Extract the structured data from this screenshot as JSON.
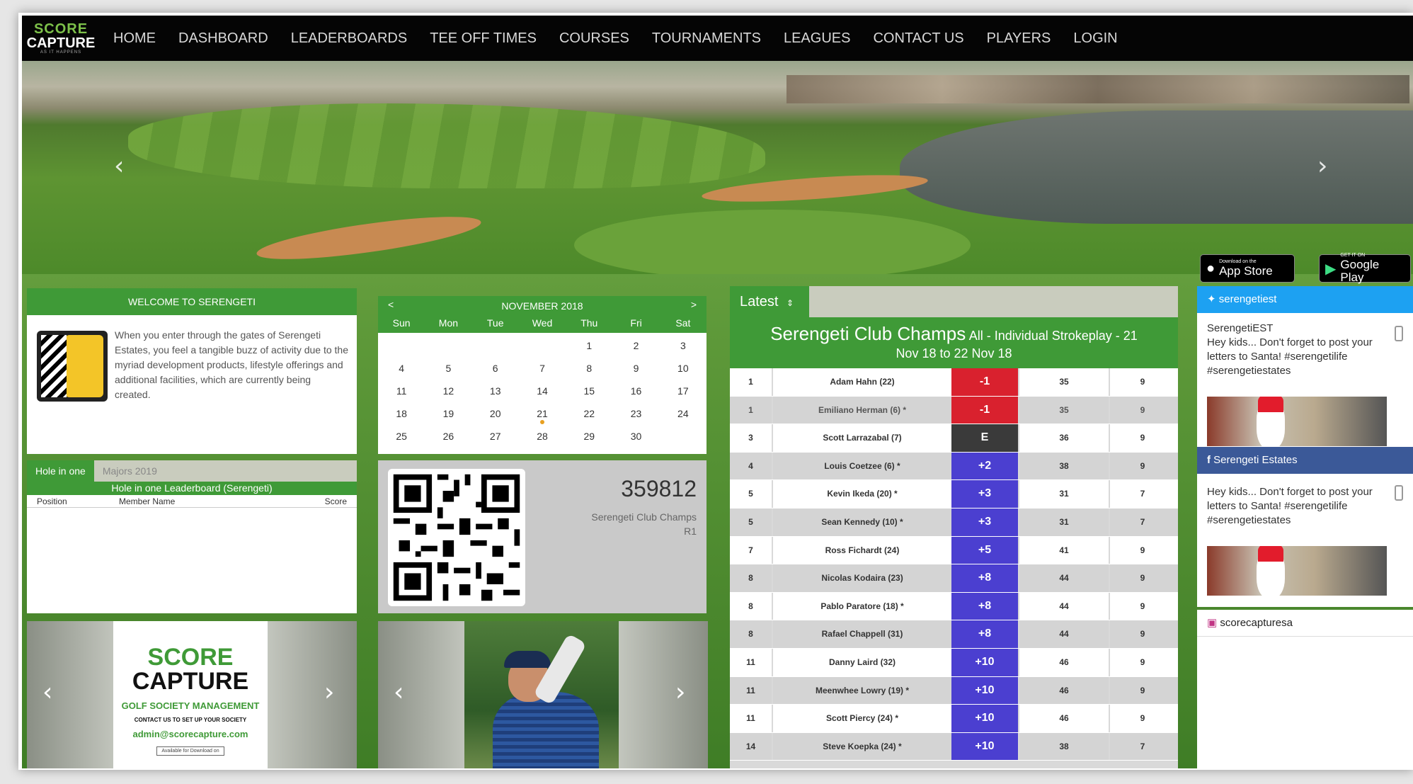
{
  "nav": {
    "logo_top": "SCORE",
    "logo_bottom": "CAPTURE",
    "logo_tag": "AS IT HAPPENS",
    "items": [
      "HOME",
      "DASHBOARD",
      "LEADERBOARDS",
      "TEE OFF TIMES",
      "COURSES",
      "TOURNAMENTS",
      "LEAGUES",
      "CONTACT US",
      "PLAYERS",
      "LOGIN"
    ]
  },
  "hero": {
    "prev": "‹",
    "next": "›",
    "appstore": {
      "small": "Download on the",
      "big": "App Store",
      "icon": "apple-icon"
    },
    "googleplay": {
      "small": "GET IT ON",
      "big": "Google Play",
      "icon": "play-icon"
    }
  },
  "welcome": {
    "title": "WELCOME TO SERENGETI",
    "text": "When you enter through the gates of Serengeti Estates, you feel a tangible buzz of activity due to the myriad development products, lifestyle offerings and additional facilities, which are currently being created."
  },
  "hio": {
    "tab_active": "Hole in one",
    "tab_inactive": "Majors 2019",
    "subtitle": "Hole in one Leaderboard (Serengeti)",
    "cols": {
      "position": "Position",
      "member": "Member Name",
      "score": "Score"
    }
  },
  "calendar": {
    "month": "NOVEMBER 2018",
    "prev": "<",
    "next": ">",
    "days": [
      "Sun",
      "Mon",
      "Tue",
      "Wed",
      "Thu",
      "Fri",
      "Sat"
    ],
    "weeks": [
      [
        "",
        "",
        "",
        "",
        "1",
        "2",
        "3"
      ],
      [
        "4",
        "5",
        "6",
        "7",
        "8",
        "9",
        "10"
      ],
      [
        "11",
        "12",
        "13",
        "14",
        "15",
        "16",
        "17"
      ],
      [
        "18",
        "19",
        "20",
        "21",
        "22",
        "23",
        "24"
      ],
      [
        "25",
        "26",
        "27",
        "28",
        "29",
        "30",
        ""
      ]
    ]
  },
  "qr": {
    "number": "359812",
    "event": "Serengeti Club Champs",
    "round": "R1"
  },
  "ad": {
    "l1": "SCORE",
    "l2": "CAPTURE",
    "l3": "GOLF SOCIETY MANAGEMENT",
    "l4": "CONTACT US TO SET UP YOUR SOCIETY",
    "l5": "admin@scorecapture.com",
    "l6": "Available for Download on"
  },
  "leaderboard": {
    "tab": "Latest",
    "tab_icon": "sort-icon",
    "title": "Serengeti Club Champs",
    "subtitle": "All - Individual Strokeplay - 21",
    "dates": "Nov 18 to 22 Nov 18",
    "rows": [
      {
        "pos": "1",
        "name": "Adam Hahn (22)",
        "score": "-1",
        "gross": "35",
        "thru": "9",
        "color": "#d9212e",
        "grey": false
      },
      {
        "pos": "1",
        "name": "Emiliano Herman (6) *",
        "score": "-1",
        "gross": "35",
        "thru": "9",
        "color": "#d9212e",
        "grey": true
      },
      {
        "pos": "3",
        "name": "Scott Larrazabal (7)",
        "score": "E",
        "gross": "36",
        "thru": "9",
        "color": "#3a3a3a",
        "grey": false
      },
      {
        "pos": "4",
        "name": "Louis Coetzee (6) *",
        "score": "+2",
        "gross": "38",
        "thru": "9",
        "color": "#4b3fd0",
        "grey": false
      },
      {
        "pos": "5",
        "name": "Kevin Ikeda (20) *",
        "score": "+3",
        "gross": "31",
        "thru": "7",
        "color": "#4b3fd0",
        "grey": false
      },
      {
        "pos": "5",
        "name": "Sean Kennedy (10) *",
        "score": "+3",
        "gross": "31",
        "thru": "7",
        "color": "#4b3fd0",
        "grey": false
      },
      {
        "pos": "7",
        "name": "Ross Fichardt (24)",
        "score": "+5",
        "gross": "41",
        "thru": "9",
        "color": "#4b3fd0",
        "grey": false
      },
      {
        "pos": "8",
        "name": "Nicolas Kodaira (23)",
        "score": "+8",
        "gross": "44",
        "thru": "9",
        "color": "#4b3fd0",
        "grey": false
      },
      {
        "pos": "8",
        "name": "Pablo Paratore (18) *",
        "score": "+8",
        "gross": "44",
        "thru": "9",
        "color": "#4b3fd0",
        "grey": false
      },
      {
        "pos": "8",
        "name": "Rafael Chappell (31)",
        "score": "+8",
        "gross": "44",
        "thru": "9",
        "color": "#4b3fd0",
        "grey": false
      },
      {
        "pos": "11",
        "name": "Danny Laird (32)",
        "score": "+10",
        "gross": "46",
        "thru": "9",
        "color": "#4b3fd0",
        "grey": false
      },
      {
        "pos": "11",
        "name": "Meenwhee Lowry (19) *",
        "score": "+10",
        "gross": "46",
        "thru": "9",
        "color": "#4b3fd0",
        "grey": false
      },
      {
        "pos": "11",
        "name": "Scott Piercy (24) *",
        "score": "+10",
        "gross": "46",
        "thru": "9",
        "color": "#4b3fd0",
        "grey": false
      },
      {
        "pos": "14",
        "name": "Steve Koepka (24) *",
        "score": "+10",
        "gross": "38",
        "thru": "7",
        "color": "#4b3fd0",
        "grey": false
      }
    ]
  },
  "twitter": {
    "handle": "serengetiest",
    "author": "SerengetiEST",
    "text": "Hey kids... Don't forget to post your letters to Santa! #serengetilife #serengetiestates",
    "icon": "twitter-icon"
  },
  "facebook": {
    "name": "Serengeti Estates",
    "text": "Hey kids... Don't forget to post your letters to Santa! #serengetilife #serengetiestates",
    "icon": "facebook-icon"
  },
  "instagram": {
    "handle": "scorecapturesa",
    "icon": "instagram-icon"
  }
}
